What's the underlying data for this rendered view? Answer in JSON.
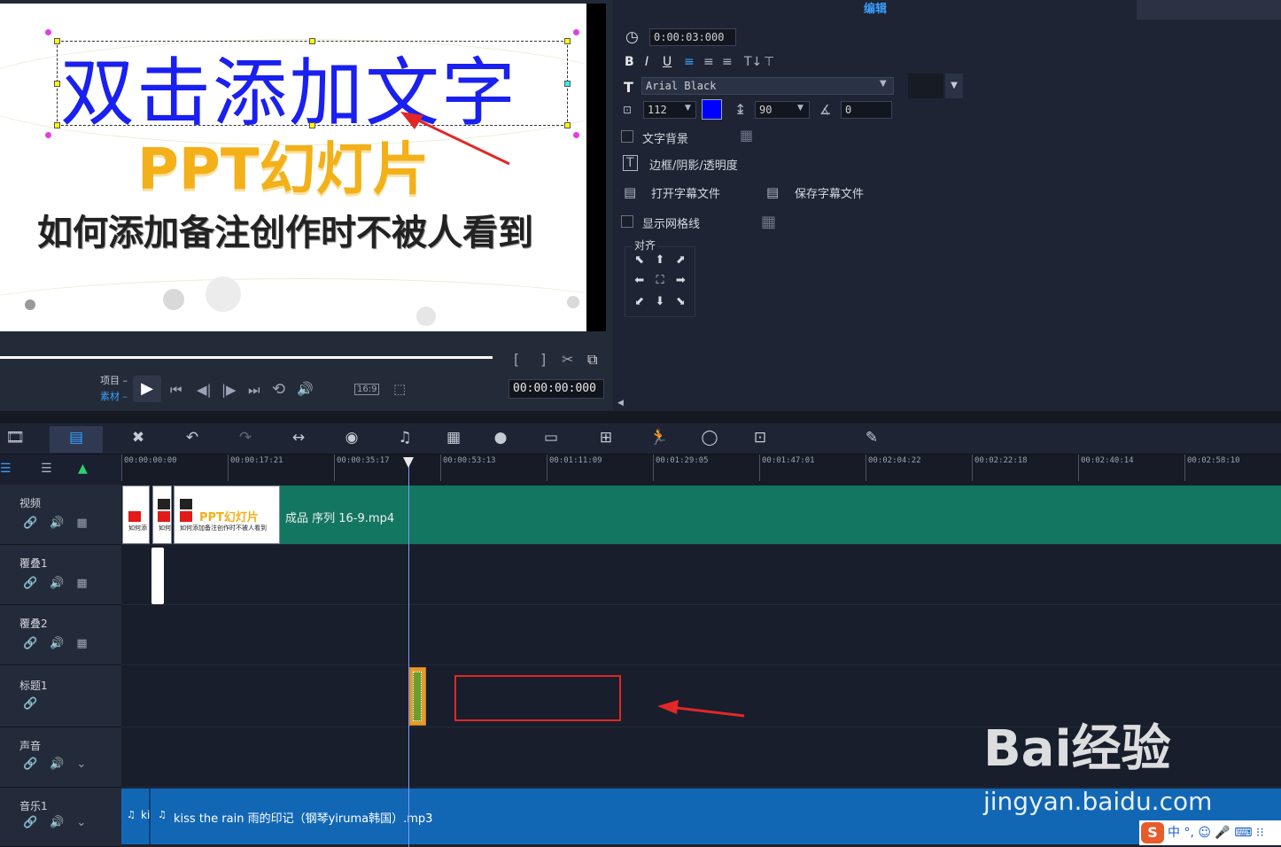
{
  "preview": {
    "title_text": "双击添加文字",
    "subtitle_text": "PPT幻灯片",
    "caption_text": "如何添加备注创作时不被人看到",
    "mode_project": "项目",
    "mode_clip": "素材",
    "aspect_ratio": "16:9",
    "timecode": "00:00:00:000",
    "bracket_in": "[",
    "bracket_out": "]"
  },
  "panel": {
    "tab_label": "编辑",
    "duration": "0:00:03:000",
    "font_name": "Arial Black",
    "font_size": "112",
    "color_swatch": "#0000ff",
    "line_spacing": "90",
    "rotation": "0",
    "text_background_label": "文字背景",
    "border_label": "边框/阴影/透明度",
    "open_subtitle_label": "打开字幕文件",
    "save_subtitle_label": "保存字幕文件",
    "show_grid_label": "显示网格线",
    "align_label": "对齐"
  },
  "ruler": {
    "ticks": [
      "00:00:00:00",
      "00:00:17:21",
      "00:00:35:17",
      "00:00:53:13",
      "00:01:11:09",
      "00:01:29:05",
      "00:01:47:01",
      "00:02:04:22",
      "00:02:22:18",
      "00:02:40:14",
      "00:02:58:10"
    ]
  },
  "tracks": [
    {
      "name": "视频"
    },
    {
      "name": "覆叠1"
    },
    {
      "name": "覆叠2"
    },
    {
      "name": "标题1"
    },
    {
      "name": "声音"
    },
    {
      "name": "音乐1"
    }
  ],
  "clips": {
    "video_label": "成品 序列 16-9.mp4",
    "thumb_title": "PPT幻灯片",
    "thumb_caption": "如何添加备注创作时不被人看到",
    "thumb_small_1": "如何添",
    "thumb_small_2": "如何",
    "music_short": "ki",
    "music_label": "kiss the rain 雨的印记（钢琴yiruma韩国）.mp3"
  },
  "watermark": {
    "brand": "Bai经验",
    "url": "jingyan.baidu.com"
  },
  "ime": {
    "logo": "S",
    "text": "中 °, ☺ 🎤 ⌨ ⁝⁝"
  },
  "colors": {
    "video_clip": "#137661",
    "music_clip": "#1267b5",
    "title_clip": "#e69b2c",
    "annotation_red": "#e12727",
    "accent_blue": "#3a9fff"
  }
}
